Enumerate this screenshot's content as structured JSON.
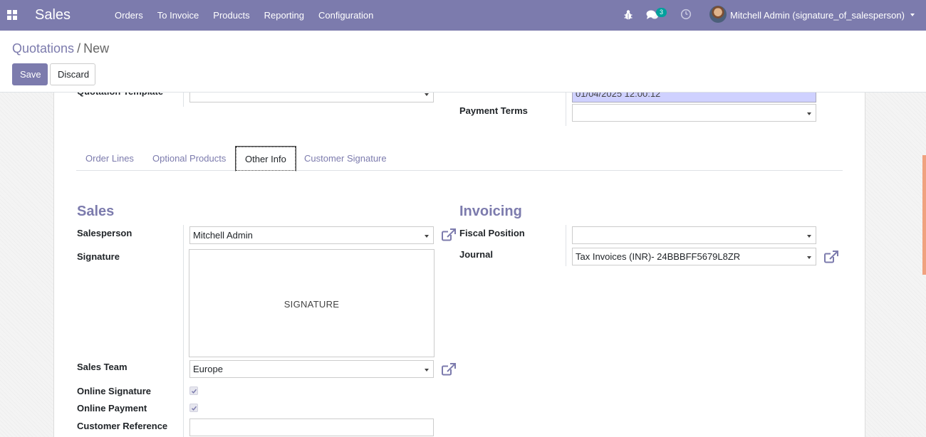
{
  "navbar": {
    "brand": "Sales",
    "menu": [
      "Orders",
      "To Invoice",
      "Products",
      "Reporting",
      "Configuration"
    ],
    "chat_count": "3",
    "user_name": "Mitchell Admin (signature_of_salesperson)",
    "bg_color": "#7c7bad"
  },
  "control_panel": {
    "breadcrumb_parent": "Quotations",
    "breadcrumb_sep": "/",
    "breadcrumb_current": "New",
    "save_label": "Save",
    "discard_label": "Discard"
  },
  "top_form": {
    "quotation_template_label": "Quotation Template",
    "quotation_template_value": "",
    "expiration_value_partial": "01/04/2025 12:00:12",
    "payment_terms_label": "Payment Terms",
    "payment_terms_value": ""
  },
  "tabs": [
    "Order Lines",
    "Optional Products",
    "Other Info",
    "Customer Signature"
  ],
  "active_tab": "Other Info",
  "sales_group": {
    "title": "Sales",
    "salesperson_label": "Salesperson",
    "salesperson_value": "Mitchell Admin",
    "signature_label": "Signature",
    "signature_placeholder": "SIGNATURE",
    "sales_team_label": "Sales Team",
    "sales_team_value": "Europe",
    "online_signature_label": "Online Signature",
    "online_signature_checked": true,
    "online_payment_label": "Online Payment",
    "online_payment_checked": true,
    "customer_reference_label": "Customer Reference",
    "customer_reference_value": ""
  },
  "invoicing_group": {
    "title": "Invoicing",
    "fiscal_position_label": "Fiscal Position",
    "fiscal_position_value": "",
    "journal_label": "Journal",
    "journal_value": "Tax Invoices (INR)- 24BBBFF5679L8ZR"
  },
  "colors": {
    "accent": "#7c7bad",
    "highlight_field": "#cfd1ff",
    "badge": "#00a09d"
  }
}
